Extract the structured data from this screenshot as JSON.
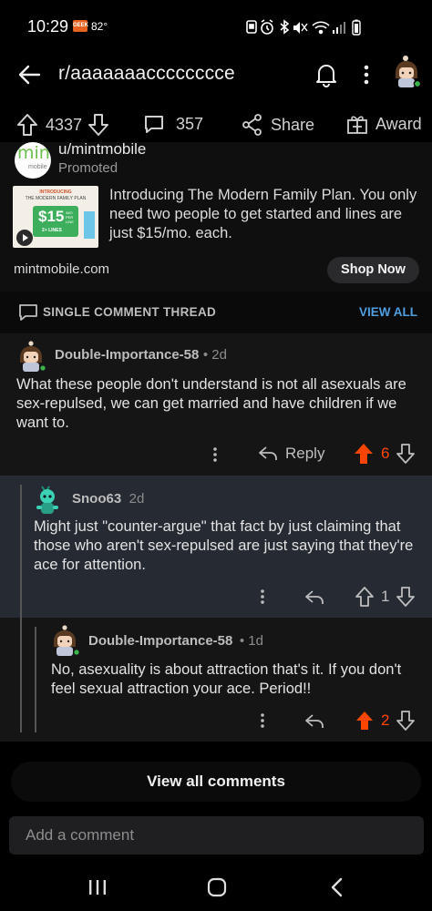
{
  "status_bar": {
    "time": "10:29",
    "badge": "GEEK",
    "temperature": "82°",
    "icons": [
      "screenshot-icon",
      "alarm-icon",
      "bluetooth-icon",
      "mute-icon",
      "wifi-icon",
      "signal-icon",
      "battery-icon"
    ]
  },
  "header": {
    "subreddit": "r/aaaaaaacccccccce",
    "icons": [
      "back-arrow-icon",
      "bell-icon",
      "more-vertical-icon",
      "user-avatar"
    ]
  },
  "post_actions": {
    "upvotes": "4337",
    "comments": "357",
    "share_label": "Share",
    "award_label": "Award"
  },
  "promo": {
    "user": "u/mintmobile",
    "label": "Promoted",
    "logo_text": "mint",
    "logo_sub": "mobile",
    "thumb_header": "INTRODUCING",
    "thumb_title": "THE MODERN FAMILY PLAN",
    "thumb_price": "$15",
    "thumb_price_unit": "/MO PER LINE",
    "thumb_lines": "2+ LINES",
    "text": "Introducing The Modern Family Plan. You only need two people to get started and lines are just $15/mo. each.",
    "domain": "mintmobile.com",
    "cta": "Shop Now"
  },
  "thread_bar": {
    "label": "SINGLE COMMENT THREAD",
    "view_all": "VIEW ALL"
  },
  "comments": [
    {
      "user": "Double-Importance-58",
      "time": "• 2d",
      "body": "What these people don't understand is not all asexuals are sex-repulsed, we can get married and have children if we want to.",
      "reply_label": "Reply",
      "score": "6",
      "upvoted": true
    },
    {
      "user": "Snoo63",
      "time": "2d",
      "body": "Might just \"counter-argue\" that fact by just claiming that those who aren't sex-repulsed are just saying that they're ace for attention.",
      "score": "1",
      "upvoted": false
    },
    {
      "user": "Double-Importance-58",
      "time": "• 1d",
      "body": "No, asexuality is about attraction that's it. If you don't feel sexual attraction your ace. Period!!",
      "score": "2",
      "upvoted": true
    }
  ],
  "view_all_comments": "View all comments",
  "add_comment_placeholder": "Add a comment",
  "colors": {
    "upvote": "#ff4500",
    "link_blue": "#4f9fe0",
    "highlight_bg": "#252a33"
  }
}
